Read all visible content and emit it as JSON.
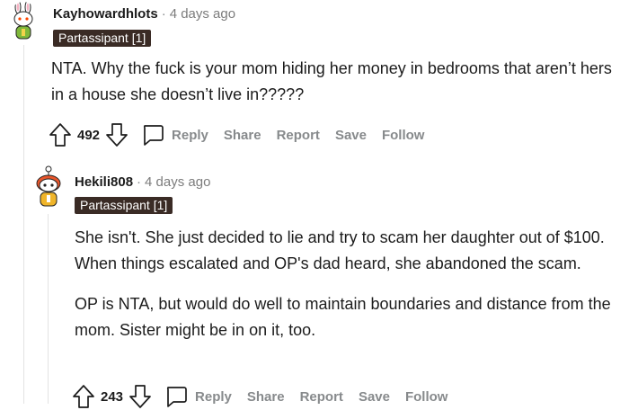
{
  "comments": [
    {
      "author": "Kayhowardhlots",
      "separator": "·",
      "time": "4 days ago",
      "flair": "Partassipant [1]",
      "body": [
        "NTA. Why the fuck is your mom hiding her money in bedrooms that aren’t hers in a house she doesn’t live in?????"
      ],
      "score": "492",
      "actions": {
        "reply": "Reply",
        "share": "Share",
        "report": "Report",
        "save": "Save",
        "follow": "Follow"
      },
      "avatar_icon": "snoo-bunny-avatar-icon"
    },
    {
      "author": "Hekili808",
      "separator": "·",
      "time": "4 days ago",
      "flair": "Partassipant [1]",
      "body": [
        "She isn't. She just decided to lie and try to scam her daughter out of $100. When things escalated and OP's dad heard, she abandoned the scam.",
        "OP is NTA, but would do well to maintain boundaries and distance from the mom. Sister might be in on it, too."
      ],
      "score": "243",
      "actions": {
        "reply": "Reply",
        "share": "Share",
        "report": "Report",
        "save": "Save",
        "follow": "Follow"
      },
      "avatar_icon": "snoo-red-hair-avatar-icon"
    }
  ],
  "colors": {
    "flair_bg": "#3a2b25",
    "muted": "#878a8c",
    "text": "#1c1c1c",
    "thread_line": "#e3e3e3"
  }
}
